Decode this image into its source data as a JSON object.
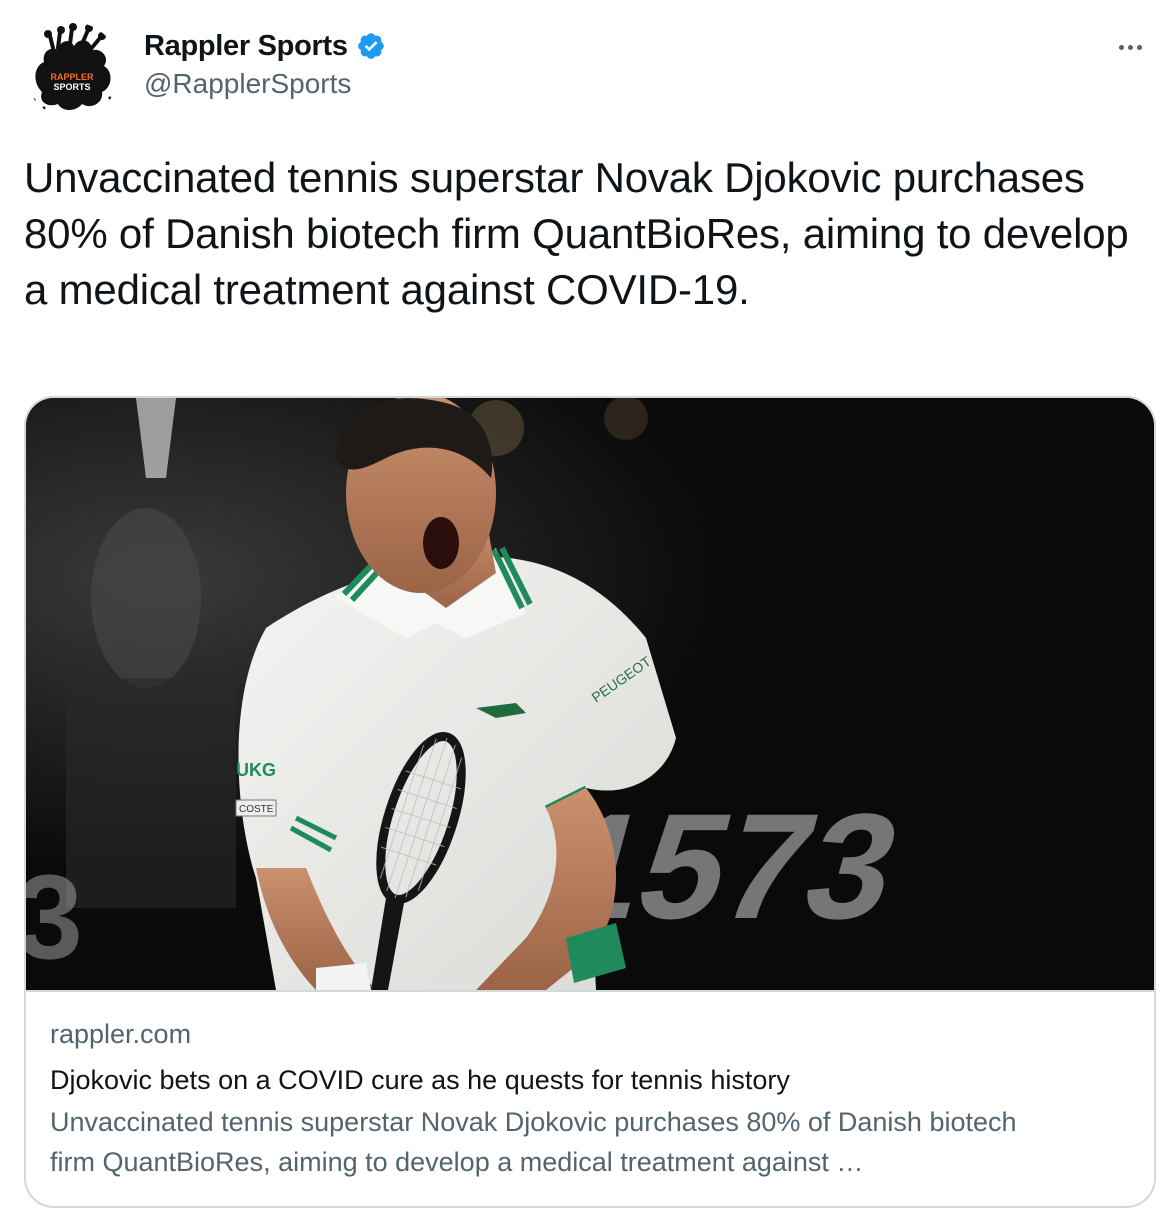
{
  "author": {
    "name": "Rappler Sports",
    "handle": "@RapplerSports",
    "avatar_text": [
      "RAPPLER",
      "SPORTS"
    ],
    "verified": true
  },
  "icons": {
    "verified": "verified-badge-icon",
    "more": "more-options-icon"
  },
  "tweet": {
    "text": "Unvaccinated tennis superstar Novak Djokovic purchases 80% of Danish biotech firm QuantBioRes, aiming to develop a medical treatment against COVID-19."
  },
  "card": {
    "domain": "rappler.com",
    "title": "Djokovic bets on a COVID cure as he quests for tennis history",
    "description": "Unvaccinated tennis superstar Novak Djokovic purchases 80% of Danish biotech firm QuantBioRes, aiming to develop a medical treatment against …",
    "image_text": {
      "shirt_brand": "PEUGEOT",
      "sleeve": "UKG",
      "patch": "COSTE",
      "background_number": "1573"
    }
  },
  "colors": {
    "verified": "#1d9bf0",
    "text_primary": "#0f1419",
    "text_secondary": "#536471",
    "border": "#cfd9de",
    "accent_green": "#1f8a5b"
  }
}
